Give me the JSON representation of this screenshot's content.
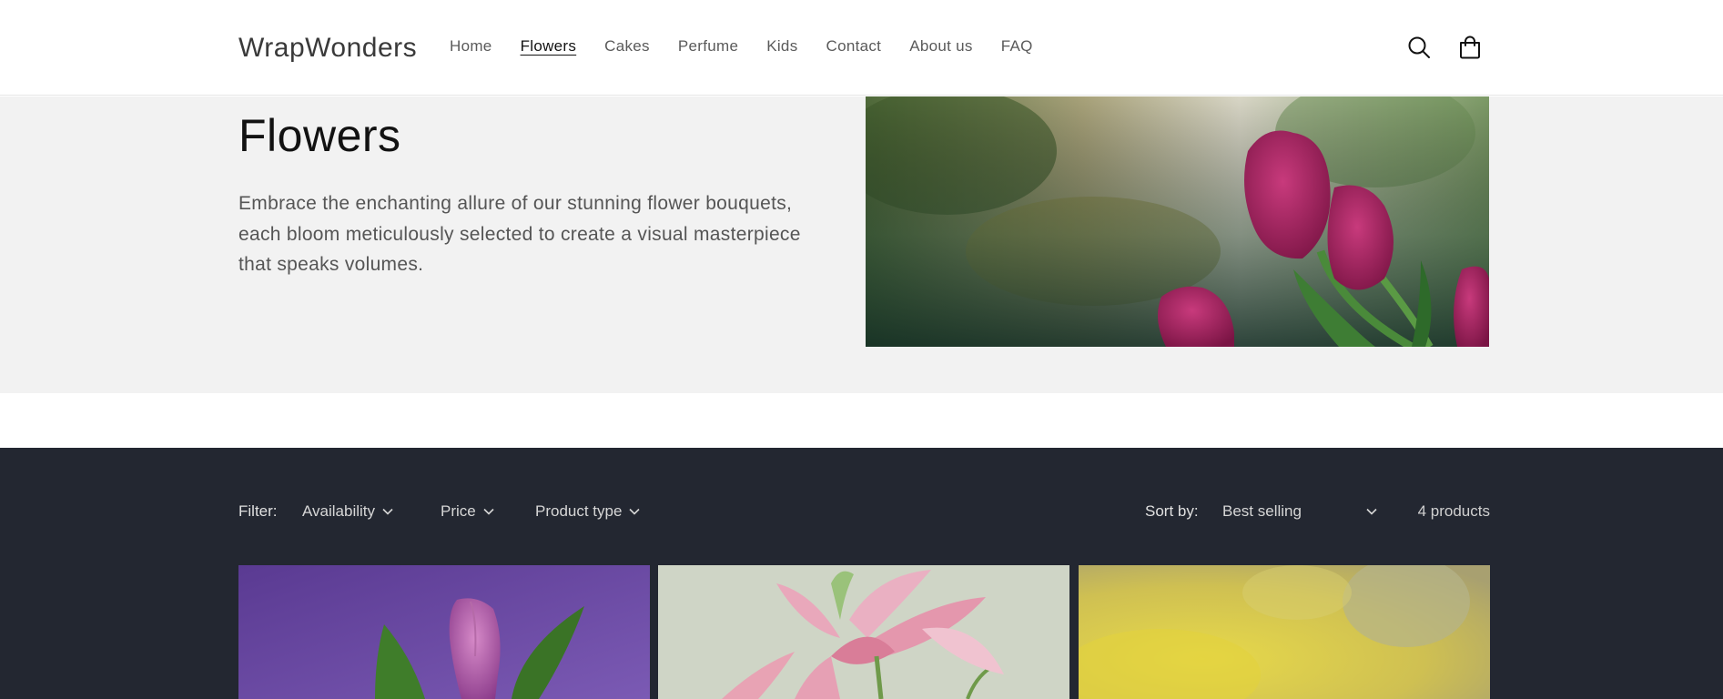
{
  "header": {
    "logo": "WrapWonders",
    "nav": [
      {
        "label": "Home"
      },
      {
        "label": "Flowers",
        "active": true
      },
      {
        "label": "Cakes"
      },
      {
        "label": "Perfume"
      },
      {
        "label": "Kids"
      },
      {
        "label": "Contact"
      },
      {
        "label": "About us"
      },
      {
        "label": "FAQ"
      }
    ],
    "icons": {
      "search": "search-icon",
      "cart": "cart-icon"
    }
  },
  "banner": {
    "title": "Flowers",
    "description": "Embrace the enchanting allure of our stunning flower bouquets, each bloom meticulously selected to create a visual masterpiece that speaks volumes.",
    "image": "tulips-image"
  },
  "filters": {
    "label": "Filter:",
    "items": [
      "Availability",
      "Price",
      "Product type"
    ],
    "sort_label": "Sort by:",
    "sort_value": "Best selling",
    "count": "4 products"
  },
  "products": [
    {
      "image": "purple-tulip-image"
    },
    {
      "image": "pink-lily-image"
    },
    {
      "image": "yellow-flower-image"
    }
  ],
  "colors": {
    "banner_bg": "#f2f2f2",
    "dark_section": "#232731",
    "text_dark": "#121212"
  }
}
